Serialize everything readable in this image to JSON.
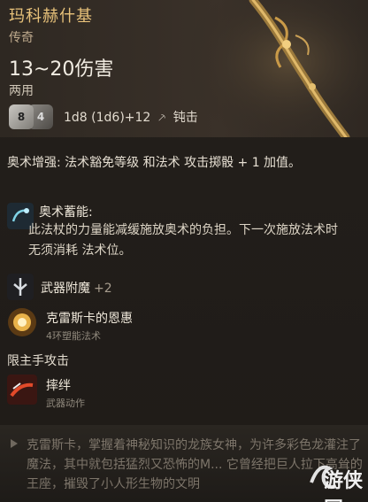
{
  "item": {
    "name": "玛科赫什基",
    "rarity": "传奇",
    "damage": "13~20伤害",
    "handed": "两用",
    "dice_left": "8",
    "dice_right": "4",
    "dice_formula": "1d8 (1d6)+12",
    "damage_type": "钝击"
  },
  "passive": {
    "text": "奥术增强: 法术豁免等级 和法术 攻击掷骰 + 1 加值。"
  },
  "abilities": [
    {
      "title": "奥术蓄能:",
      "desc": "此法杖的力量能减缓施放奥术的负担。下一次施放法术时无须消耗 法术位。",
      "icon": "arcane-charge-icon"
    },
    {
      "title": "武器附魔",
      "value": "+2",
      "icon": "weapon-enchant-icon"
    },
    {
      "title": "克雷斯卡的恩惠",
      "sub": "4环塑能法术",
      "icon": "sun-sigil-icon"
    },
    {
      "title": "摔绊",
      "sub": "武器动作",
      "icon": "trip-icon"
    }
  ],
  "section": {
    "main_hand": "限主手攻击"
  },
  "lore": "克雷斯卡，掌握着神秘知识的龙族女神，为许多彩色龙灌注了魔法，其中就包括猛烈又恐怖的M... 它曾经把巨人拉下高耸的王座，摧毁了小人形生物的文明",
  "watermark": "游侠网",
  "colors": {
    "name": "#e8c27a",
    "background": "#221e1a"
  }
}
